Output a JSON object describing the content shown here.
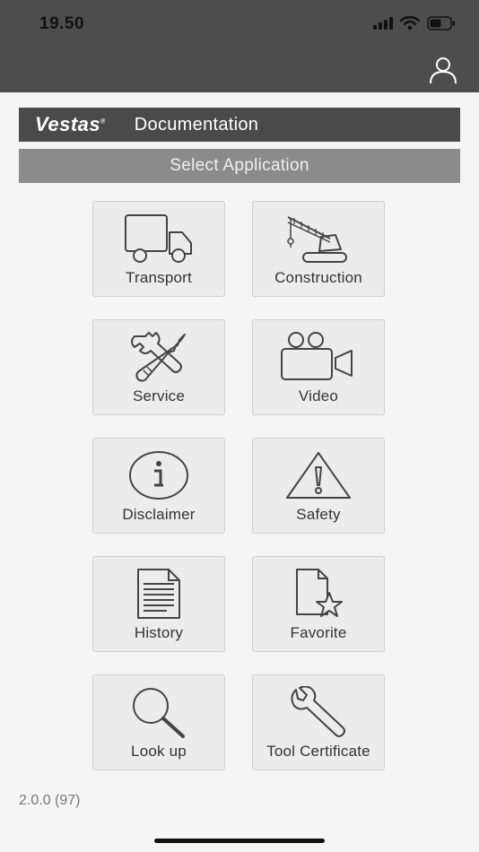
{
  "status": {
    "time": "19.50"
  },
  "header": {
    "brand": "Vestas",
    "title": "Documentation"
  },
  "select_bar": {
    "label": "Select Application"
  },
  "tiles": [
    {
      "label": "Transport",
      "icon": "truck-icon"
    },
    {
      "label": "Construction",
      "icon": "crane-icon"
    },
    {
      "label": "Service",
      "icon": "tools-icon"
    },
    {
      "label": "Video",
      "icon": "video-camera-icon"
    },
    {
      "label": "Disclaimer",
      "icon": "info-icon"
    },
    {
      "label": "Safety",
      "icon": "warning-icon"
    },
    {
      "label": "History",
      "icon": "document-icon"
    },
    {
      "label": "Favorite",
      "icon": "favorite-document-icon"
    },
    {
      "label": "Look up",
      "icon": "search-icon"
    },
    {
      "label": "Tool Certificate",
      "icon": "wrench-icon"
    }
  ],
  "version": "2.0.0 (97)"
}
